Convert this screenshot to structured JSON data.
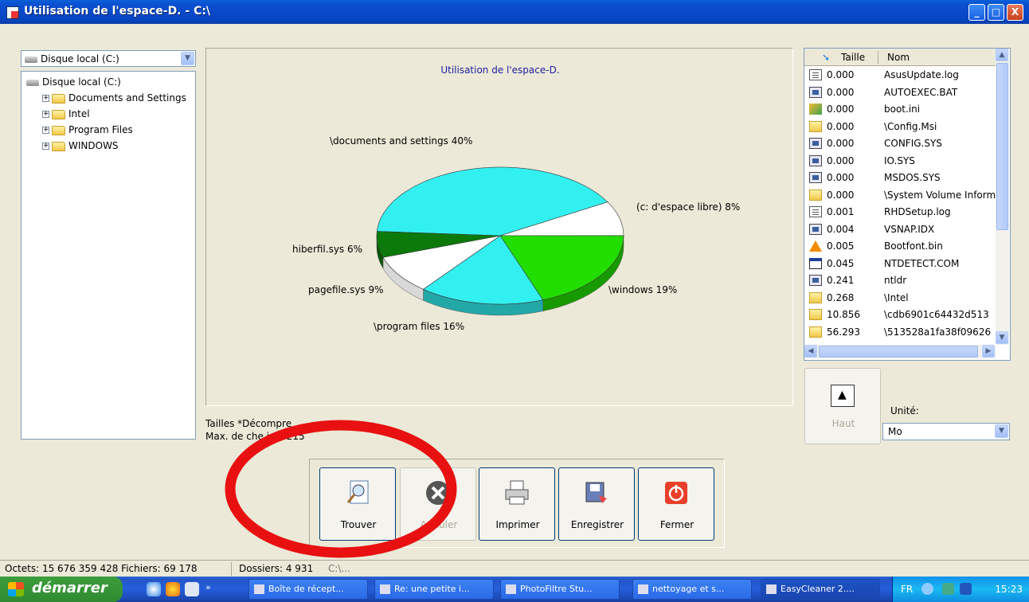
{
  "window": {
    "title": "Utilisation de l'espace-D. - C:\\",
    "controls": [
      "_",
      "□",
      "X"
    ]
  },
  "drive_selector": {
    "value": "Disque local (C:)"
  },
  "tree": {
    "root": "Disque local (C:)",
    "children": [
      "Documents and Settings",
      "Intel",
      "Program Files",
      "WINDOWS"
    ]
  },
  "chart_data": {
    "type": "pie",
    "title": "Utilisation de l'espace-D.",
    "labels": [
      "\\documents and settings 40%",
      "(c: d'espace libre) 8%",
      "\\windows 19%",
      "\\program files 16%",
      "pagefile.sys 9%",
      "hiberfil.sys 6%"
    ],
    "values": [
      40,
      8,
      19,
      16,
      9,
      6
    ],
    "colors": [
      "#33f0f0",
      "#ffffff",
      "#22dd00",
      "#33f0f0",
      "#ffffff",
      "#0b7a0b"
    ]
  },
  "info": {
    "line1": "Tailles *Décompre",
    "line2": "Max. de che   ins: 215"
  },
  "file_list": {
    "columns": [
      "Taille",
      "Nom"
    ],
    "rows": [
      {
        "size": "0.000",
        "name": "AsusUpdate.log",
        "icon": "doc"
      },
      {
        "size": "0.000",
        "name": "AUTOEXEC.BAT",
        "icon": "sys"
      },
      {
        "size": "0.000",
        "name": "boot.ini",
        "icon": "img"
      },
      {
        "size": "0.000",
        "name": "\\Config.Msi",
        "icon": "folder2"
      },
      {
        "size": "0.000",
        "name": "CONFIG.SYS",
        "icon": "sys"
      },
      {
        "size": "0.000",
        "name": "IO.SYS",
        "icon": "sys"
      },
      {
        "size": "0.000",
        "name": "MSDOS.SYS",
        "icon": "sys"
      },
      {
        "size": "0.000",
        "name": "\\System Volume Inform",
        "icon": "folder2"
      },
      {
        "size": "0.001",
        "name": "RHDSetup.log",
        "icon": "doc"
      },
      {
        "size": "0.004",
        "name": "VSNAP.IDX",
        "icon": "sys"
      },
      {
        "size": "0.005",
        "name": "Bootfont.bin",
        "icon": "cone"
      },
      {
        "size": "0.045",
        "name": "NTDETECT.COM",
        "icon": "com"
      },
      {
        "size": "0.241",
        "name": "ntldr",
        "icon": "sys"
      },
      {
        "size": "0.268",
        "name": "\\Intel",
        "icon": "folder2"
      },
      {
        "size": "10.856",
        "name": "\\cdb6901c64432d513",
        "icon": "folder2"
      },
      {
        "size": "56.293",
        "name": "\\513528a1fa38f09626",
        "icon": "folder2"
      }
    ]
  },
  "haut_button": {
    "label": "Haut"
  },
  "unit": {
    "label": "Unité:",
    "value": "Mo"
  },
  "actions": {
    "find": "Trouver",
    "cancel": "Annuler",
    "print": "Imprimer",
    "save": "Enregistrer",
    "close": "Fermer"
  },
  "status": {
    "bytes": "Octets: 15 676 359 428 Fichiers: 69 178",
    "dirs": "Dossiers: 4 931",
    "extra": "C:\\..."
  },
  "taskbar": {
    "start": "démarrer",
    "tasks": [
      "Boîte de récept...",
      "Re: une petite i...",
      "PhotoFiltre Stu...",
      "nettoyage et s...",
      "EasyCleaner 2...."
    ],
    "lang": "FR",
    "clock": "15:23"
  }
}
